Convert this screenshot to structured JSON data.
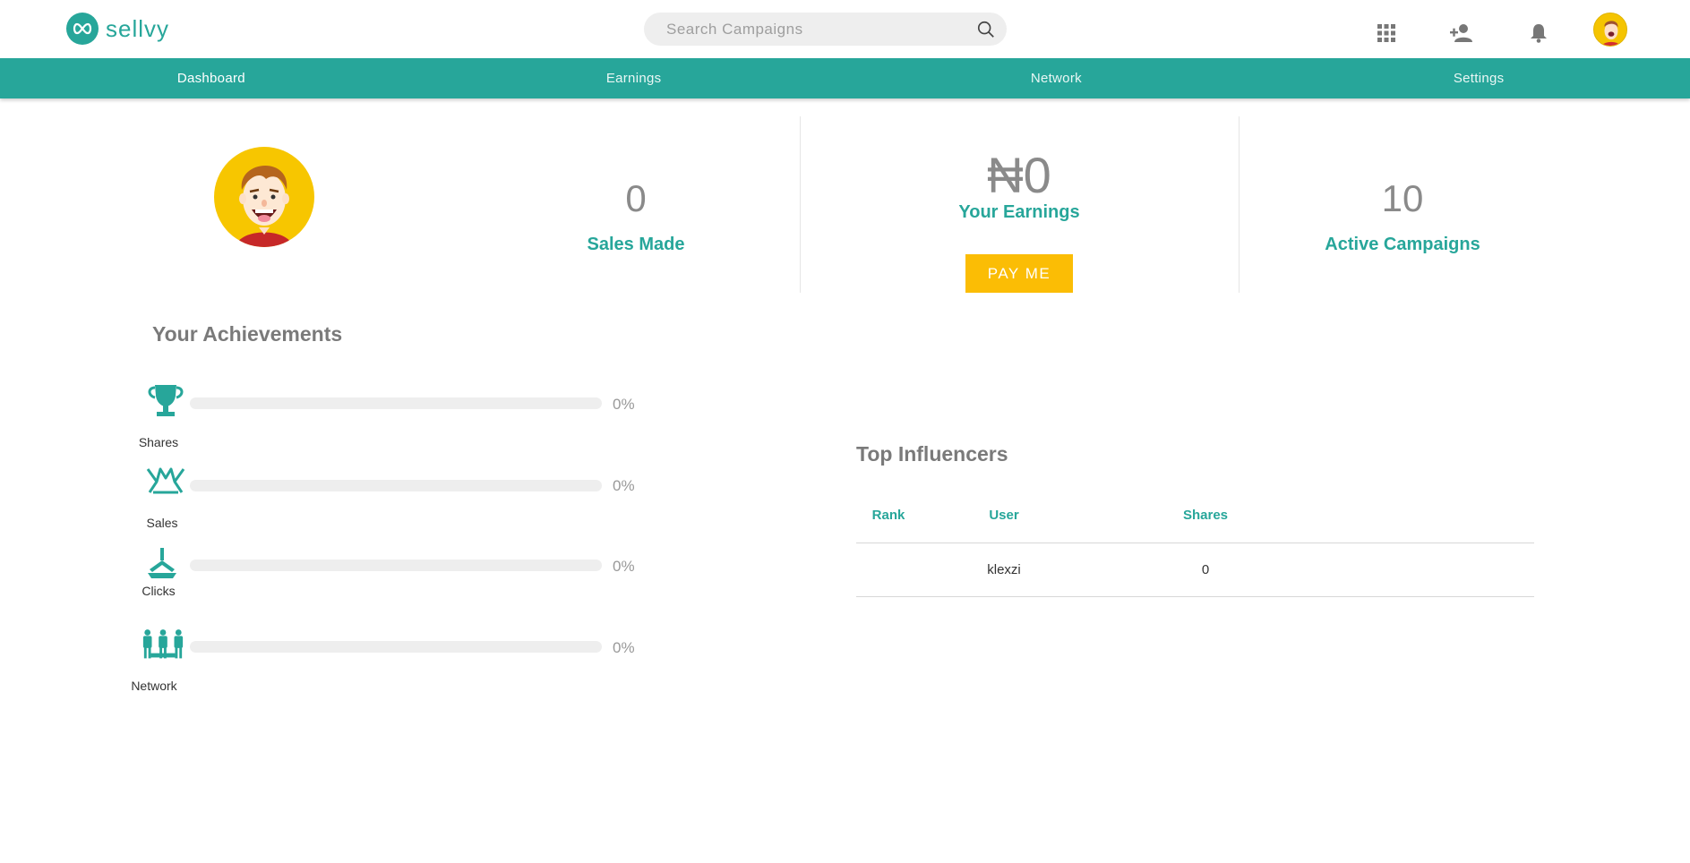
{
  "header": {
    "brand": "sellvy",
    "search_placeholder": "Search Campaigns",
    "icons": [
      "apps-grid-icon",
      "add-user-icon",
      "bell-icon",
      "user-avatar"
    ]
  },
  "nav": {
    "items": [
      {
        "label": "Dashboard",
        "active": true
      },
      {
        "label": "Earnings",
        "active": false
      },
      {
        "label": "Network",
        "active": false
      },
      {
        "label": "Settings",
        "active": false
      }
    ]
  },
  "stats": {
    "sales_made": {
      "value": "0",
      "label": "Sales Made"
    },
    "earnings": {
      "currency": "₦",
      "value": "0",
      "label": "Your Earnings",
      "button": "PAY ME"
    },
    "active_campaigns": {
      "value": "10",
      "label": "Active Campaigns"
    }
  },
  "achievements": {
    "title": "Your Achievements",
    "items": [
      {
        "label": "Shares",
        "percent_text": "0%",
        "progress": 0,
        "icon": "trophy-icon"
      },
      {
        "label": "Sales",
        "percent_text": "0%",
        "progress": 0,
        "icon": "sales-icon"
      },
      {
        "label": "Clicks",
        "percent_text": "0%",
        "progress": 0,
        "icon": "clicks-icon"
      },
      {
        "label": "Network",
        "percent_text": "0%",
        "progress": 0,
        "icon": "network-icon"
      }
    ]
  },
  "influencers": {
    "title": "Top Influencers",
    "columns": [
      "Rank",
      "User",
      "Shares"
    ],
    "rows": [
      {
        "rank": "",
        "user": "klexzi",
        "shares": "0"
      }
    ]
  },
  "colors": {
    "primary": "#27a69a",
    "accent": "#fbbd05",
    "avatar_bg": "#f7c600"
  }
}
